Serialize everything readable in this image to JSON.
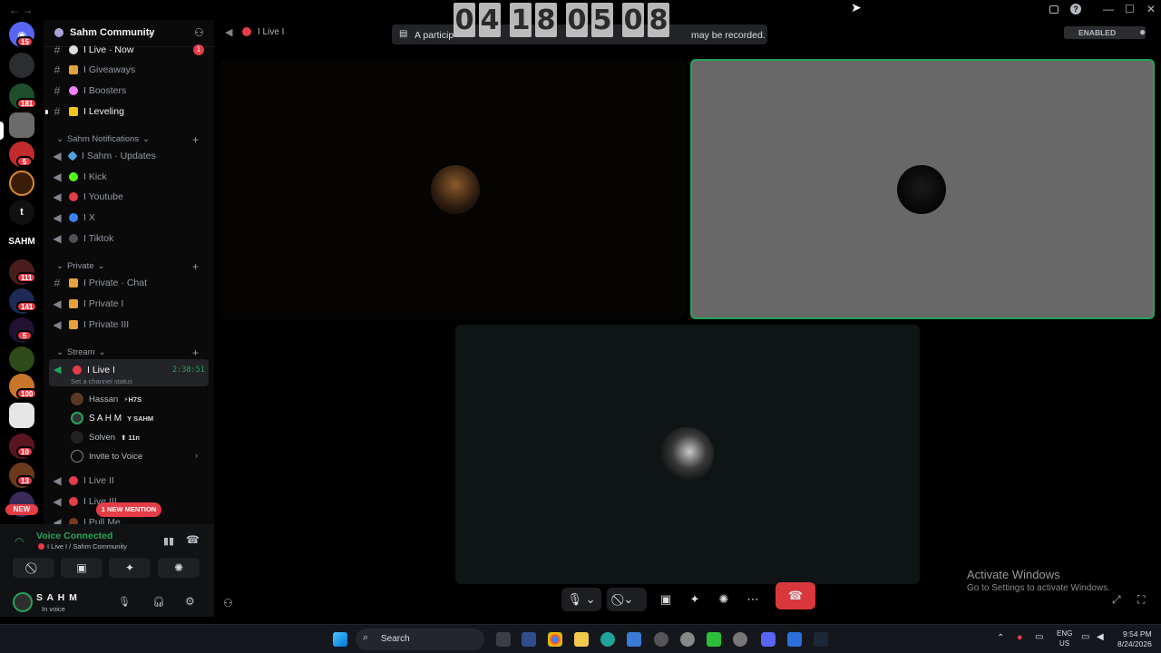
{
  "titlebar": {
    "back_glyph": "←",
    "fwd_glyph": "→",
    "inbox_icon": "inbox-icon",
    "help_glyph": "?",
    "min_glyph": "—",
    "max_glyph": "☐",
    "close_glyph": "✕"
  },
  "rail": {
    "home_badge": "15",
    "badges": [
      "181",
      "5",
      "111",
      "141",
      "5",
      "100",
      "10",
      "13"
    ],
    "text_server": "t",
    "sahm_text": "SAHM",
    "new_label": "NEW"
  },
  "sidebar": {
    "server_name": "Sahm Community",
    "channels_top": [
      {
        "label": "I Live · Now",
        "badge": "1"
      },
      {
        "label": "I Giveaways"
      },
      {
        "label": "I Boosters"
      },
      {
        "label": "I Leveling"
      }
    ],
    "cat_notifications": "Sahm Notifications",
    "notif_channels": [
      "I Sahm · Updates",
      "I Kick",
      "I Youtube",
      "I X",
      "I Tiktok"
    ],
    "cat_private": "Private",
    "private_channels": [
      "I Private · Chat",
      "I Private I",
      "I Private III"
    ],
    "cat_stream": "Stream",
    "live_channel": "I Live I",
    "live_timer": "2:38:51",
    "channel_status": "Set a channel status",
    "voice_users": [
      {
        "name": "Hassan",
        "tag": "⚡H7S"
      },
      {
        "name": "S A H M",
        "tag": "Y SAHM"
      },
      {
        "name": "Solven",
        "tag": "⬆ 11n"
      }
    ],
    "invite_label": "Invite to Voice",
    "more_channels": [
      "I Live II",
      "I Live III",
      "I Pull Me"
    ],
    "mention_pill": "1 NEW MENTION"
  },
  "userpanel": {
    "status": "Voice Connected",
    "location": "I Live I / Sahm Community",
    "username": "S A H M",
    "user_status": "In voice"
  },
  "stage": {
    "channel_title": "I Live I",
    "notice": "A participant in this call may be recorded.",
    "notice_visible_left": "A particip",
    "notice_visible_right": "may be recorded.",
    "enabled_label": "ENABLED",
    "activate_title": "Activate Windows",
    "activate_sub": "Go to Settings to activate Windows."
  },
  "timer": {
    "digits": [
      "0",
      "4",
      "1",
      "8",
      "0",
      "5",
      "0",
      "8"
    ]
  },
  "taskbar": {
    "search": "Search",
    "lang": "ENG",
    "region": "US",
    "time": "9:54 PM",
    "date": "8/24/2026"
  },
  "colors": {
    "accent_green": "#23a55a",
    "live_red": "#e53d47",
    "call_red": "#da373c"
  }
}
